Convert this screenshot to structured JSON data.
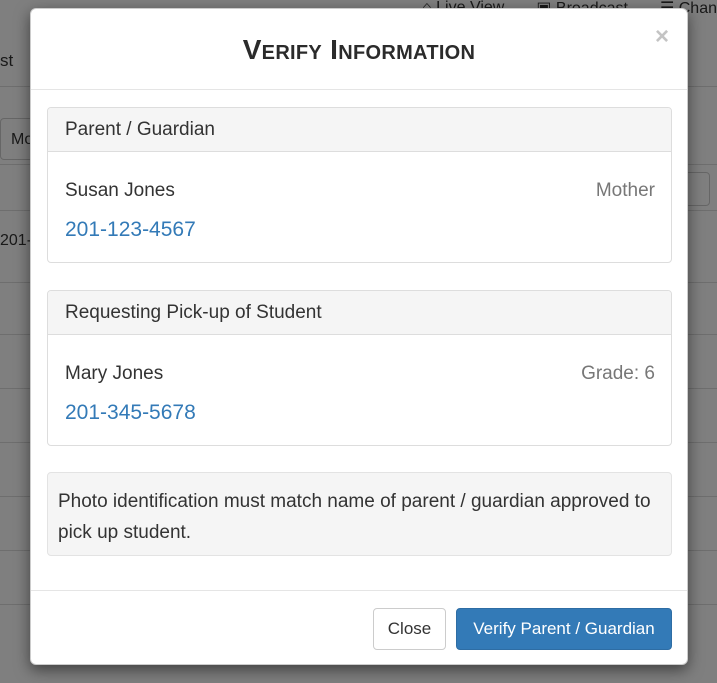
{
  "background": {
    "topbar": {
      "live_view": "Live View",
      "broadcast": "Broadcast",
      "chan": "Chan"
    },
    "tab_fragment": "st",
    "button_fragment": "Mo",
    "cell_fragment": "201-"
  },
  "modal": {
    "title": "Verify Information",
    "close_glyph": "×",
    "guardian_panel": {
      "heading": "Parent / Guardian",
      "name": "Susan Jones",
      "relation": "Mother",
      "phone": "201-123-4567"
    },
    "student_panel": {
      "heading": "Requesting Pick-up of Student",
      "name": "Mary Jones",
      "grade": "Grade: 6",
      "phone": "201-345-5678"
    },
    "notice": "Photo identification must match name of parent / guardian approved to pick up student.",
    "footer": {
      "close_label": "Close",
      "verify_label": "Verify Parent / Guardian"
    }
  },
  "colors": {
    "primary": "#337ab7",
    "link": "#337ab7",
    "muted": "#777777",
    "panel_heading_bg": "#f5f5f5"
  }
}
